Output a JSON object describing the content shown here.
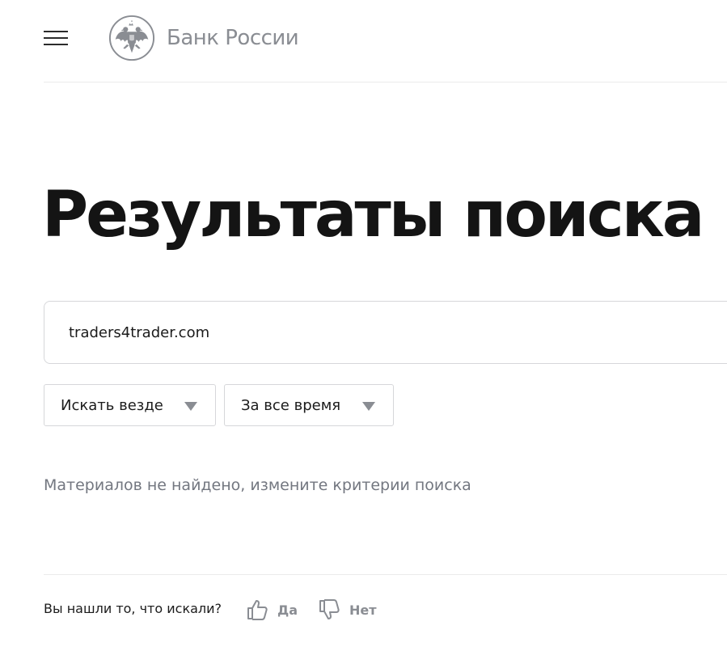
{
  "header": {
    "logo_text": "Банк России",
    "menu_icon": "hamburger-menu-icon",
    "emblem_icon": "double-headed-eagle-emblem-icon"
  },
  "page": {
    "title": "Результаты поиска"
  },
  "search": {
    "value": "traders4trader.com"
  },
  "filters": {
    "where": {
      "label": "Искать везде",
      "icon": "chevron-down-icon"
    },
    "time": {
      "label": "За все время",
      "icon": "chevron-down-icon"
    }
  },
  "results": {
    "empty_message": "Материалов не найдено, измените критерии поиска"
  },
  "feedback": {
    "question": "Вы нашли то, что искали?",
    "yes_label": "Да",
    "no_label": "Нет",
    "yes_icon": "thumbs-up-icon",
    "no_icon": "thumbs-down-icon"
  },
  "colors": {
    "title": "#141414",
    "muted_text": "#737780",
    "gray_accent": "#8a8d93",
    "border": "#d6d7da",
    "divider": "#ebebeb"
  }
}
